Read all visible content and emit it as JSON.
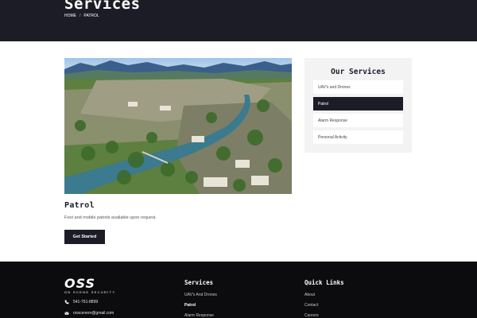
{
  "hero": {
    "title": "Services",
    "breadcrumb": {
      "home": "HOME",
      "separator": "/",
      "current": "PATROL"
    }
  },
  "main": {
    "image_alt": "Aerial view of a river town with mountains",
    "heading": "Patrol",
    "description": "Foot and mobile patrols available upon request.",
    "cta_label": "Get Started"
  },
  "sidebar": {
    "title": "Our Services",
    "items": [
      {
        "label": "UAV's and Drones",
        "active": false
      },
      {
        "label": "Patrol",
        "active": true
      },
      {
        "label": "Alarm Response",
        "active": false
      },
      {
        "label": "Personal Activity",
        "active": false
      }
    ]
  },
  "footer": {
    "logo_text": "OSS",
    "logo_subtext": "ON SCENE SECURITY",
    "phone": "541-761-8899",
    "email": "onsceneor@gmail.com",
    "services_title": "Services",
    "services_links": [
      "UAV's And Drones",
      "Patrol",
      "Alarm Response"
    ],
    "quick_title": "Quick Links",
    "quick_links": [
      "About",
      "Contact",
      "Careers"
    ]
  },
  "colors": {
    "dark": "#1c1c27",
    "footer": "#0c0c0f",
    "sidebar_bg": "#f3f3f3"
  }
}
